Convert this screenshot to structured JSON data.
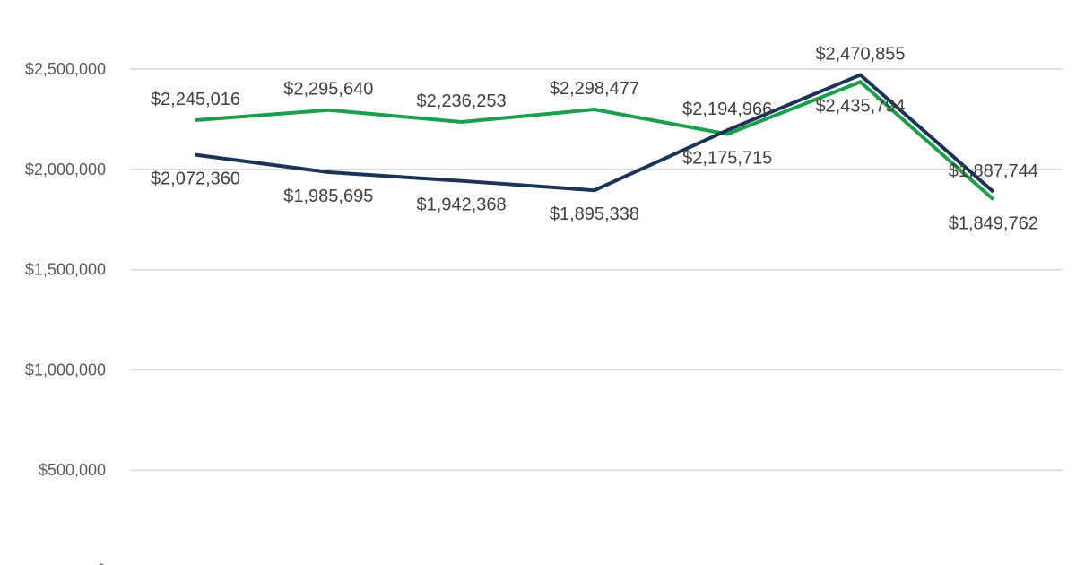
{
  "chart_data": {
    "type": "line",
    "title": "",
    "xlabel": "",
    "ylabel": "",
    "categories": [
      "",
      "",
      "",
      "",
      "",
      "",
      ""
    ],
    "ylim": [
      0,
      2700000
    ],
    "y_ticks": [
      {
        "value": 0,
        "label": "$"
      },
      {
        "value": 500000,
        "label": "$500,000"
      },
      {
        "value": 1000000,
        "label": "$1,000,000"
      },
      {
        "value": 1500000,
        "label": "$1,500,000"
      },
      {
        "value": 2000000,
        "label": "$2,000,000"
      },
      {
        "value": 2500000,
        "label": "$2,500,000"
      }
    ],
    "grid": true,
    "legend": "none",
    "series": [
      {
        "color": "#1a9f4b",
        "values": [
          2245016,
          2295640,
          2236253,
          2298477,
          2175715,
          2435794,
          1849762
        ],
        "labels": [
          "$2,245,016",
          "$2,295,640",
          "$2,236,253",
          "$2,298,477",
          "$2,175,715",
          "$2,435,794",
          "$1,849,762"
        ],
        "label_positions": [
          "above",
          "above",
          "above",
          "above",
          "below",
          "below",
          "below"
        ]
      },
      {
        "color": "#1b3358",
        "values": [
          2072360,
          1985695,
          1942368,
          1895338,
          2194966,
          2470855,
          1887744
        ],
        "labels": [
          "$2,072,360",
          "$1,985,695",
          "$1,942,368",
          "$1,895,338",
          "$2,194,966",
          "$2,470,855",
          "$1,887,744"
        ],
        "label_positions": [
          "below",
          "below",
          "below",
          "below",
          "above",
          "above",
          "above"
        ]
      }
    ]
  }
}
